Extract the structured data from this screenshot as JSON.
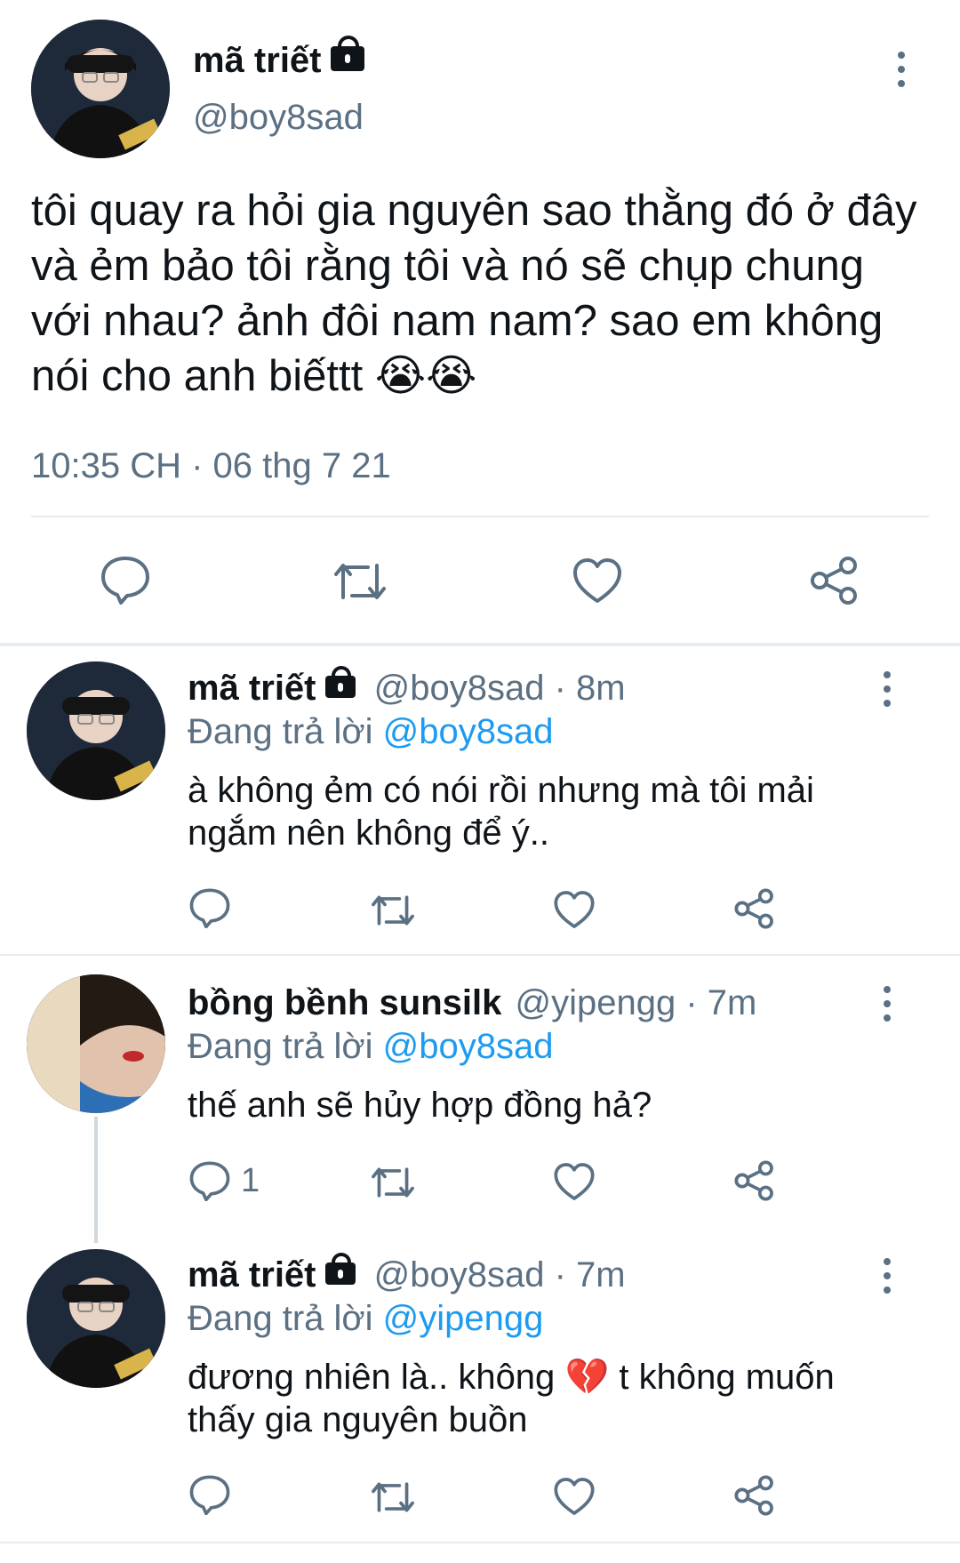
{
  "main_tweet": {
    "display_name": "mã triết",
    "handle": "@boy8sad",
    "text": "tôi quay ra hỏi gia nguyên sao thằng đó ở đây và ẻm bảo tôi rằng tôi và nó sẽ chụp chung với nhau? ảnh đôi nam nam? sao em không nói cho anh biếttt",
    "emoji": "😭😭",
    "timestamp": "10:35 CH · 06 thg 7 21"
  },
  "replies": [
    {
      "display_name": "mã triết",
      "handle": "@boy8sad",
      "time": "· 8m",
      "replying_label": "Đang trả lời",
      "replying_to": "@boy8sad",
      "text": "à không ẻm có nói rồi nhưng mà tôi mải ngắm nên không để ý..",
      "reply_count": ""
    },
    {
      "display_name": "bồng bềnh sunsilk",
      "handle": "@yipengg",
      "time": "· 7m",
      "replying_label": "Đang trả lời",
      "replying_to": "@boy8sad",
      "text": "thế anh sẽ hủy hợp đồng hả?",
      "reply_count": "1"
    },
    {
      "display_name": "mã triết",
      "handle": "@boy8sad",
      "time": "· 7m",
      "replying_label": "Đang trả lời",
      "replying_to": "@yipengg",
      "text_before": "đương nhiên là.. không",
      "emoji": "💔",
      "text_after": "t không muốn thấy gia nguyên buồn",
      "reply_count": ""
    }
  ],
  "icons": {
    "reply": "speech-bubble-icon",
    "retweet": "retweet-icon",
    "like": "heart-icon",
    "share": "share-icon",
    "more": "more-vertical-icon",
    "protected": "lock-icon"
  },
  "colors": {
    "text": "#0f1419",
    "muted": "#5b7083",
    "link": "#1d9bf0",
    "divider": "#e6ecf0"
  }
}
